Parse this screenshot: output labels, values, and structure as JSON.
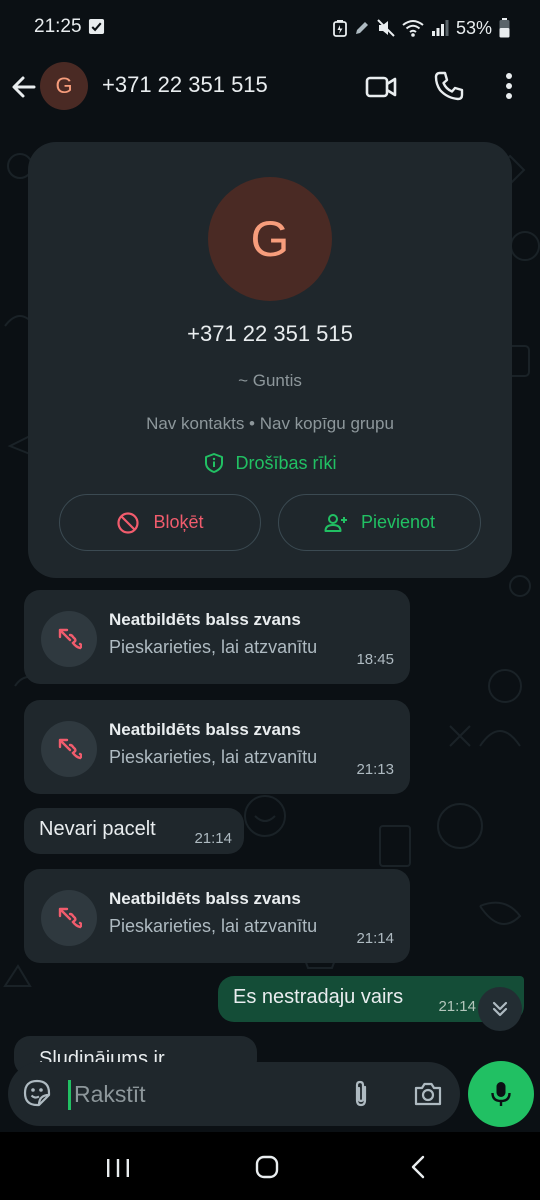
{
  "status_bar": {
    "time": "21:25",
    "battery_percent": "53%",
    "icons": [
      "check-box-icon",
      "battery-saver-icon",
      "pen-icon",
      "mute-icon",
      "wifi-icon",
      "signal-icon",
      "battery-icon"
    ]
  },
  "header": {
    "avatar_letter": "G",
    "title": "+371 22 351 515",
    "icons": [
      "back-icon",
      "video-call-icon",
      "voice-call-icon",
      "more-options-icon"
    ]
  },
  "profile_card": {
    "avatar_letter": "G",
    "phone_number": "+371 22 351 515",
    "push_name": "~ Guntis",
    "meta": "Nav kontakts • Nav kopīgu grupu",
    "safety_tools_label": "Drošības rīki",
    "block_label": "Bloķēt",
    "add_label": "Pievienot"
  },
  "messages": [
    {
      "type": "missed_call",
      "title": "Neatbildēts balss zvans",
      "subtitle": "Pieskarieties, lai atzvanītu",
      "time": "18:45"
    },
    {
      "type": "missed_call",
      "title": "Neatbildēts balss zvans",
      "subtitle": "Pieskarieties, lai atzvanītu",
      "time": "21:13"
    },
    {
      "type": "incoming_text",
      "text": "Nevari pacelt",
      "time": "21:14"
    },
    {
      "type": "missed_call",
      "title": "Neatbildēts balss zvans",
      "subtitle": "Pieskarieties, lai atzvanītu",
      "time": "21:14"
    },
    {
      "type": "outgoing_text",
      "text": "Es nestradaju vairs",
      "time": "21:14"
    },
    {
      "type": "incoming_text_partial",
      "text": "Sludinājums ir"
    }
  ],
  "input": {
    "placeholder": "Rakstīt"
  },
  "colors": {
    "accent_green": "#21c063",
    "missed_call_red": "#f15c6d",
    "background": "#0b1014",
    "bubble_incoming": "#1f272c",
    "bubble_outgoing": "#144d37",
    "avatar_bg": "#4a2a24",
    "avatar_letter": "#f79d7c"
  }
}
